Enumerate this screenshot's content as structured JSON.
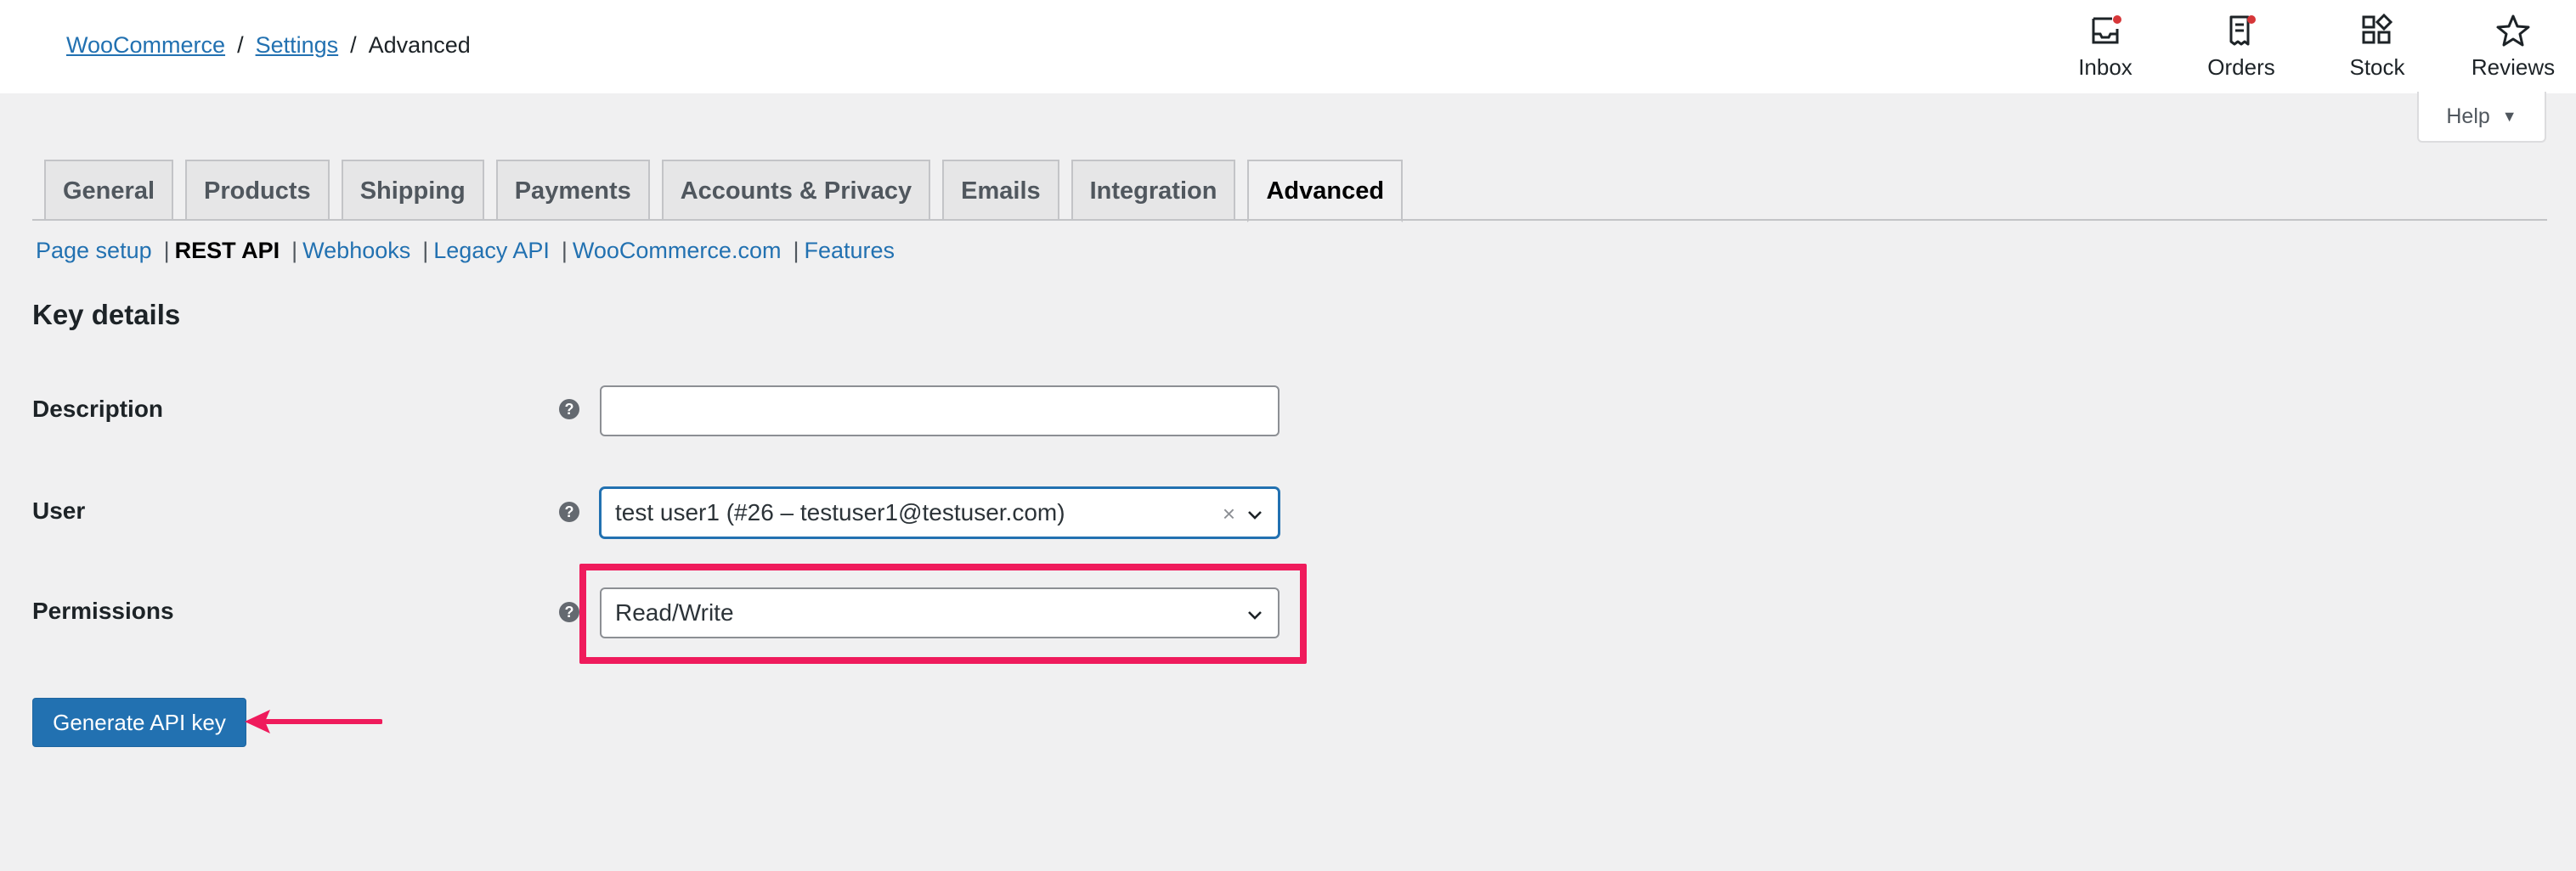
{
  "breadcrumb": {
    "root": "WooCommerce",
    "sep1": "/",
    "parent": "Settings",
    "sep2": "/",
    "current": "Advanced"
  },
  "activity": [
    {
      "label": "Inbox",
      "icon": "inbox-icon"
    },
    {
      "label": "Orders",
      "icon": "orders-icon"
    },
    {
      "label": "Stock",
      "icon": "stock-icon"
    },
    {
      "label": "Reviews",
      "icon": "reviews-icon"
    }
  ],
  "help": {
    "label": "Help",
    "caret": "▼"
  },
  "tabs": [
    {
      "label": "General"
    },
    {
      "label": "Products"
    },
    {
      "label": "Shipping"
    },
    {
      "label": "Payments"
    },
    {
      "label": "Accounts & Privacy"
    },
    {
      "label": "Emails"
    },
    {
      "label": "Integration"
    },
    {
      "label": "Advanced",
      "active": true
    }
  ],
  "subnav": [
    {
      "label": "Page setup"
    },
    {
      "label": "REST API",
      "current": true
    },
    {
      "label": "Webhooks"
    },
    {
      "label": "Legacy API"
    },
    {
      "label": "WooCommerce.com"
    },
    {
      "label": "Features"
    }
  ],
  "section": {
    "title": "Key details"
  },
  "form": {
    "description": {
      "label": "Description",
      "value": ""
    },
    "user": {
      "label": "User",
      "value": "test user1 (#26 – testuser1@testuser.com)",
      "clear": "×"
    },
    "permissions": {
      "label": "Permissions",
      "value": "Read/Write"
    },
    "help_tip": "?"
  },
  "actions": {
    "generate_label": "Generate API key"
  },
  "colors": {
    "accent": "#2271b1",
    "annotation": "#ef1b5c",
    "notification": "#d63638"
  }
}
